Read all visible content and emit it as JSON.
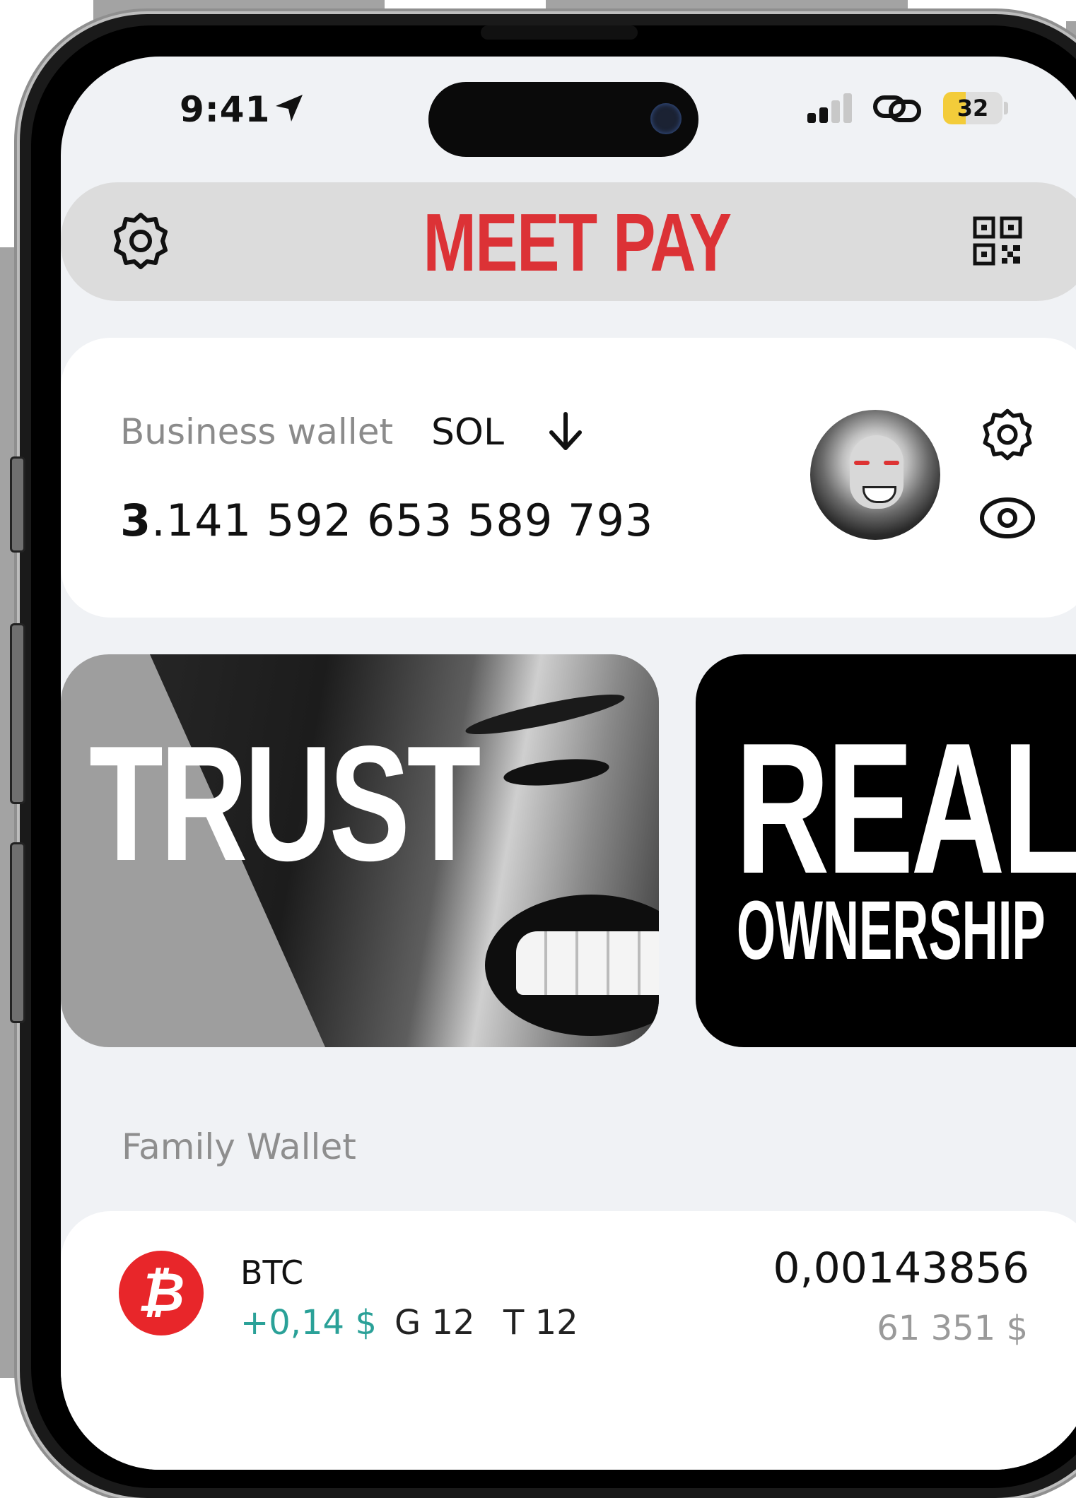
{
  "status_bar": {
    "time": "9:41",
    "battery": "32"
  },
  "header": {
    "brand": "MEET PAY",
    "brand_color": "#dc3236"
  },
  "wallet": {
    "label": "Business wallet",
    "currency": "SOL",
    "balance_int": "3",
    "balance_rest": ".141 592 653 589 793"
  },
  "banners": [
    {
      "line1": "TRUST"
    },
    {
      "line1": "REAL",
      "line2": "OWNERSHIP"
    }
  ],
  "family_wallet": {
    "title": "Family Wallet",
    "items": [
      {
        "symbol": "BTC",
        "icon_glyph": "₿",
        "change": "+0,14 $",
        "g": "G 12",
        "t": "T 12",
        "amount": "0,00143856",
        "usd": "61 351 $"
      }
    ]
  },
  "colors": {
    "accent_red": "#dc3236",
    "positive": "#2aa198",
    "btc": "#e8262a"
  }
}
